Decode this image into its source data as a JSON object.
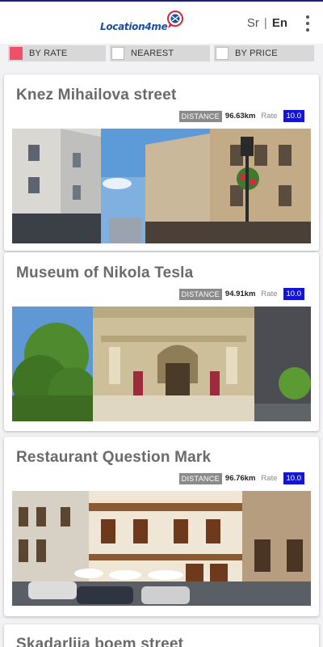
{
  "app": {
    "logo_text": "Location4me"
  },
  "language": {
    "sr": "Sr",
    "separator": "|",
    "en": "En"
  },
  "filters": [
    {
      "label": "BY RATE",
      "checked": true
    },
    {
      "label": "NEAREST",
      "checked": false
    },
    {
      "label": "BY PRICE",
      "checked": false
    }
  ],
  "places": [
    {
      "title": "Knez Mihailova street",
      "distance_label": "DISTANCE",
      "distance": "96.63km",
      "rate_label": "Rate",
      "rate": "10.0"
    },
    {
      "title": "Museum of Nikola Tesla",
      "distance_label": "DISTANCE",
      "distance": "94.91km",
      "rate_label": "Rate",
      "rate": "10.0"
    },
    {
      "title": "Restaurant Question Mark",
      "distance_label": "DISTANCE",
      "distance": "96.76km",
      "rate_label": "Rate",
      "rate": "10.0"
    },
    {
      "title": "Skadarlija boem street"
    }
  ],
  "colors": {
    "accent": "#ef4f6a",
    "rate_badge": "#1414d6",
    "header_bar": "#1a1f7a",
    "logo": "#1b4fa3"
  }
}
